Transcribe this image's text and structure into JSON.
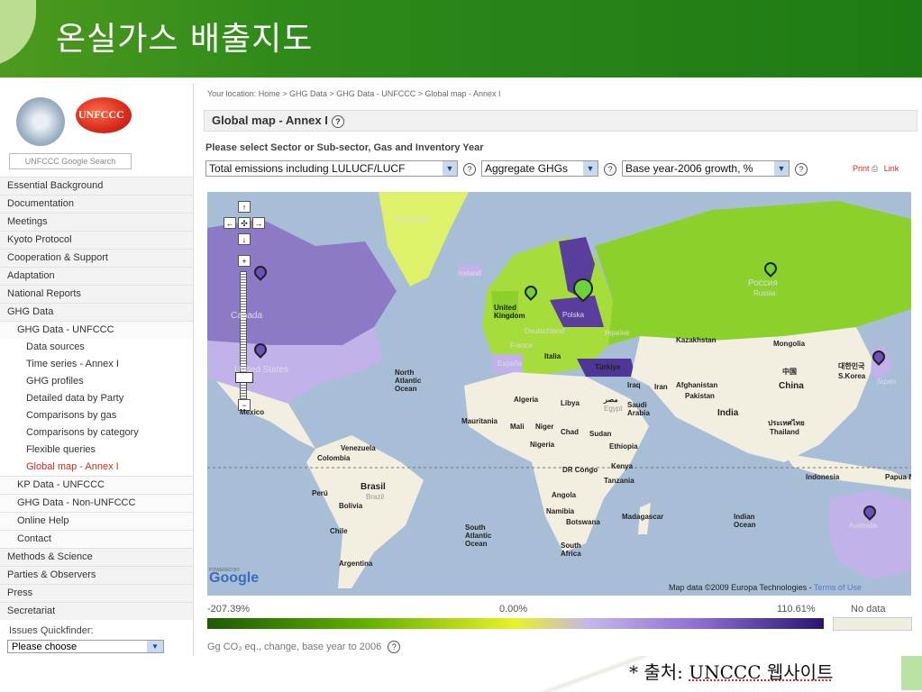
{
  "slide": {
    "title": "온실가스 배출지도"
  },
  "sidebar": {
    "search_label": "UNFCCC Google Search",
    "unfccc_logo_text": "UNFCCC",
    "nav": [
      {
        "label": "Essential Background",
        "level": 1
      },
      {
        "label": "Documentation",
        "level": 1
      },
      {
        "label": "Meetings",
        "level": 1
      },
      {
        "label": "Kyoto Protocol",
        "level": 1
      },
      {
        "label": "Cooperation & Support",
        "level": 1
      },
      {
        "label": "Adaptation",
        "level": 1
      },
      {
        "label": "National Reports",
        "level": 1
      },
      {
        "label": "GHG Data",
        "level": 1
      },
      {
        "label": "GHG Data - UNFCCC",
        "level": 2
      },
      {
        "label": "Data sources",
        "level": 3
      },
      {
        "label": "Time series - Annex I",
        "level": 3
      },
      {
        "label": "GHG profiles",
        "level": 3
      },
      {
        "label": "Detailed data by Party",
        "level": 3
      },
      {
        "label": "Comparisons by gas",
        "level": 3
      },
      {
        "label": "Comparisons by category",
        "level": 3
      },
      {
        "label": "Flexible queries",
        "level": 3
      },
      {
        "label": "Global map - Annex I",
        "level": 3,
        "active": true
      },
      {
        "label": "KP Data - UNFCCC",
        "level": 2
      },
      {
        "label": "GHG Data - Non-UNFCCC",
        "level": 2
      },
      {
        "label": "Online Help",
        "level": 2
      },
      {
        "label": "Contact",
        "level": 2
      },
      {
        "label": "Methods & Science",
        "level": 1
      },
      {
        "label": "Parties & Observers",
        "level": 1
      },
      {
        "label": "Press",
        "level": 1
      },
      {
        "label": "Secretariat",
        "level": 1
      }
    ],
    "quickfinder_label": "Issues Quickfinder:",
    "quickfinder_value": "Please choose"
  },
  "main": {
    "breadcrumb": "Your location: Home > GHG Data > GHG Data - UNFCCC > Global map - Annex I",
    "title": "Global map - Annex I",
    "instruction": "Please select Sector or Sub-sector, Gas and Inventory Year",
    "selects": {
      "sector": "Total emissions including LULUCF/LUCF",
      "gas": "Aggregate GHGs",
      "year": "Base year-2006 growth, %"
    },
    "print_label": "Print",
    "link_label": "Link",
    "help_glyph": "?"
  },
  "map": {
    "labels": {
      "greenland": "Greenland",
      "iceland": "Iceland",
      "canada": "Canada",
      "united_states": "United States",
      "mexico": "Mexico",
      "north_atlantic": "North Atlantic Ocean",
      "south_atlantic": "South Atlantic Ocean",
      "venezuela": "Venezuela",
      "colombia": "Colombia",
      "brasil": "Brasil",
      "brazil": "Brazil",
      "peru": "Perú",
      "bolivia": "Bolivia",
      "chile": "Chile",
      "argentina": "Argentina",
      "uk": "United Kingdom",
      "deutschland": "Deutschland",
      "polska": "Polska",
      "ukraine": "Україна",
      "france": "France",
      "espana": "España",
      "italia": "Italia",
      "turkiye": "Türkiye",
      "rossiya": "Россия",
      "russia": "Russia",
      "kazakhstan": "Kazakhstan",
      "mongolia": "Mongolia",
      "china_cjk": "中国",
      "china": "China",
      "korea_cjk": "대한민국",
      "s_korea": "S.Korea",
      "japan": "Japan",
      "iraq": "Iraq",
      "iran": "Iran",
      "afghanistan": "Afghanistan",
      "pakistan": "Pakistan",
      "india": "India",
      "thailand_local": "ประเทศไทย",
      "thailand": "Thailand",
      "indonesia": "Indonesia",
      "papua": "Papua New Guinea",
      "algeria": "Algeria",
      "libya": "Libya",
      "egypt_ar": "مصر",
      "egypt": "Egypt",
      "saudi": "Saudi Arabia",
      "mauritania": "Mauritania",
      "mali": "Mali",
      "niger": "Niger",
      "chad": "Chad",
      "sudan": "Sudan",
      "ethiopia": "Ethiopia",
      "nigeria": "Nigeria",
      "drcongo": "DR Congo",
      "kenya": "Kenya",
      "tanzania": "Tanzania",
      "angola": "Angola",
      "namibia": "Namibia",
      "botswana": "Botswana",
      "madagascar": "Madagascar",
      "south_africa": "South Africa",
      "indian_ocean": "Indian Ocean",
      "australia": "Australia"
    },
    "attribution": "Map data ©2009  Europa Technologies -",
    "terms": "Terms of Use",
    "powered_by": "POWERED BY",
    "google": "Google",
    "zoom_in": "+",
    "zoom_out": "−",
    "pan_up": "↑",
    "pan_down": "↓",
    "pan_left": "←",
    "pan_right": "→",
    "pan_center": "✣"
  },
  "legend": {
    "min": "-207.39%",
    "mid": "0.00%",
    "max": "110.61%",
    "no_data": "No data",
    "units": "Gg CO₂ eq., change, base year to 2006",
    "colors": [
      "#1e5a00",
      "#5fae00",
      "#e8f22a",
      "#c6b4ec",
      "#8a6ed0",
      "#2a1470"
    ]
  },
  "footer": {
    "source": "* 출처: ",
    "source_link": "UNCCC 웹사이트"
  }
}
